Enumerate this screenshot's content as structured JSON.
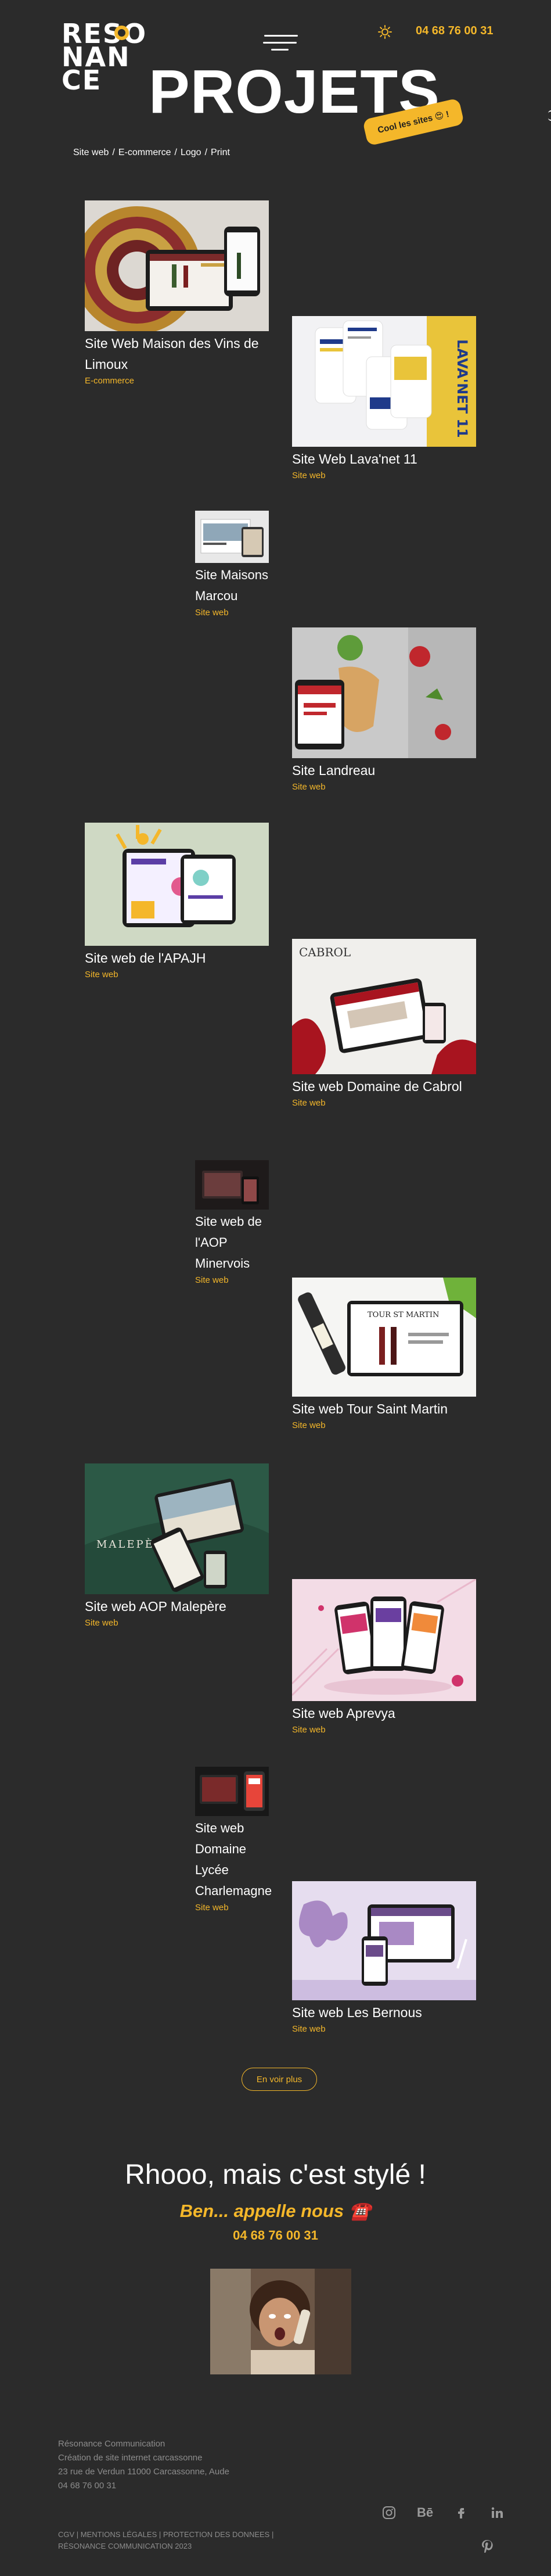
{
  "header": {
    "logo_lines": [
      "RESO",
      "NAN",
      "CE"
    ],
    "phone": "04 68 76 00 31",
    "title": "PROJETS",
    "badge": "Cool les sites 😍 !"
  },
  "filters": {
    "items": [
      "Site web",
      "E-commerce",
      "Logo",
      "Print"
    ],
    "separator": "/"
  },
  "projects": [
    {
      "title": "Site Web Maison des Vins de Limoux",
      "category": "E-commerce"
    },
    {
      "title": "Site Web Lava'net 11",
      "category": "Site web"
    },
    {
      "title": "Site Maisons Marcou",
      "category": "Site web"
    },
    {
      "title": "Site Landreau",
      "category": "Site web"
    },
    {
      "title": "Site web de l'APAJH",
      "category": "Site web"
    },
    {
      "title": "Site web Domaine de Cabrol",
      "category": "Site web"
    },
    {
      "title": "Site web de l'AOP Minervois",
      "category": "Site web"
    },
    {
      "title": "Site web Tour Saint Martin",
      "category": "Site web"
    },
    {
      "title": "Site web AOP Malepère",
      "category": "Site web"
    },
    {
      "title": "Site web Aprevya",
      "category": "Site web"
    },
    {
      "title": "Site web Domaine Lycée Charlemagne",
      "category": "Site web"
    },
    {
      "title": "Site web Les Bernous",
      "category": "Site web"
    }
  ],
  "more_button": "En voir plus",
  "cta": {
    "title": "Rhooo, mais c'est stylé !",
    "subtitle": "Ben... appelle nous ☎️",
    "phone": "04 68 76 00 31"
  },
  "footer": {
    "lines": [
      "Résonance Communication",
      "Création de site internet carcassonne",
      "23 rue de Verdun 11000 Carcassonne, Aude",
      "04 68 76 00 31"
    ],
    "legal": [
      "CGV",
      "MENTIONS LÉGALES",
      "PROTECTION DES DONNEES",
      "RÉSONANCE COMMUNICATION 2023"
    ],
    "legal_sep": " | ",
    "socials": [
      "instagram-icon",
      "behance-icon",
      "facebook-icon",
      "linkedin-icon",
      "pinterest-icon"
    ],
    "behance_label": "Bē"
  },
  "colors": {
    "background": "#2b2b2b",
    "accent": "#f4b72a",
    "text": "#ffffff",
    "muted": "#8c8c8c"
  }
}
